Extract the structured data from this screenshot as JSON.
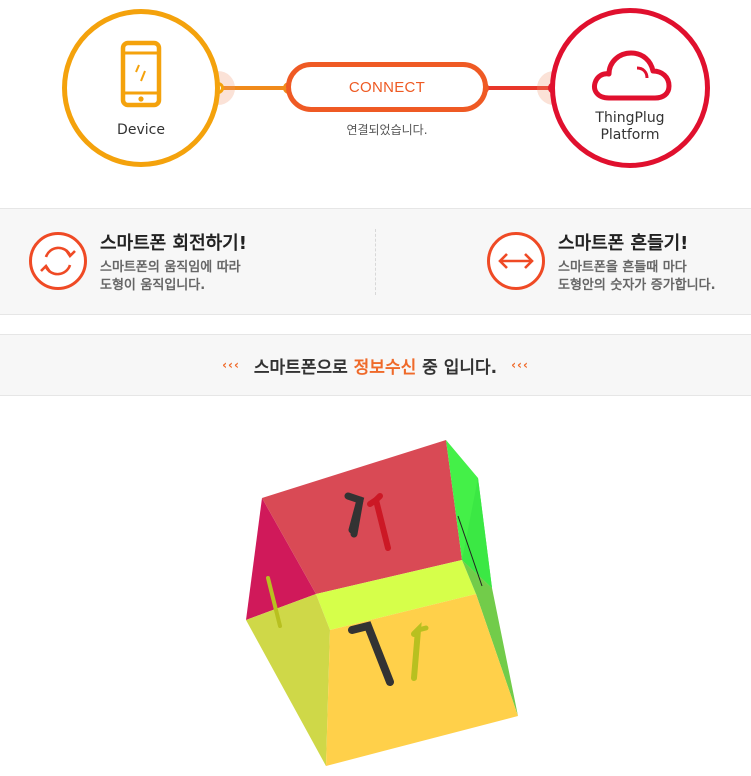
{
  "connection": {
    "device_label": "Device",
    "connect_label": "CONNECT",
    "status_text": "연결되었습니다.",
    "platform_label_line1": "ThingPlug",
    "platform_label_line2": "Platform",
    "colors": {
      "device": "#f4a20c",
      "platform": "#e0102e",
      "connect": "#ef5a24"
    }
  },
  "features": [
    {
      "title": "스마트폰 회전하기!",
      "desc_line1": "스마트폰의 움직임에 따라",
      "desc_line2": "도형이 움직입니다.",
      "icon": "rotate-icon"
    },
    {
      "title": "스마트폰 흔들기!",
      "desc_line1": "스마트폰을 흔들때 마다",
      "desc_line2": "도형안의 숫자가 증가합니다.",
      "icon": "shake-arrows-icon"
    }
  ],
  "banner": {
    "arrows_left": "‹‹‹",
    "text_before": "스마트폰으로",
    "highlight": "정보수신",
    "text_after": "중 입니다.",
    "arrows_right": "‹‹‹"
  },
  "cube": {
    "face_value": "1",
    "colors": {
      "top": "#d94a55",
      "left": "#d0195a",
      "right": "#33ee44",
      "front": "#ffd04a",
      "front_left": "#cfd848",
      "band": "#d6ff4a"
    }
  }
}
